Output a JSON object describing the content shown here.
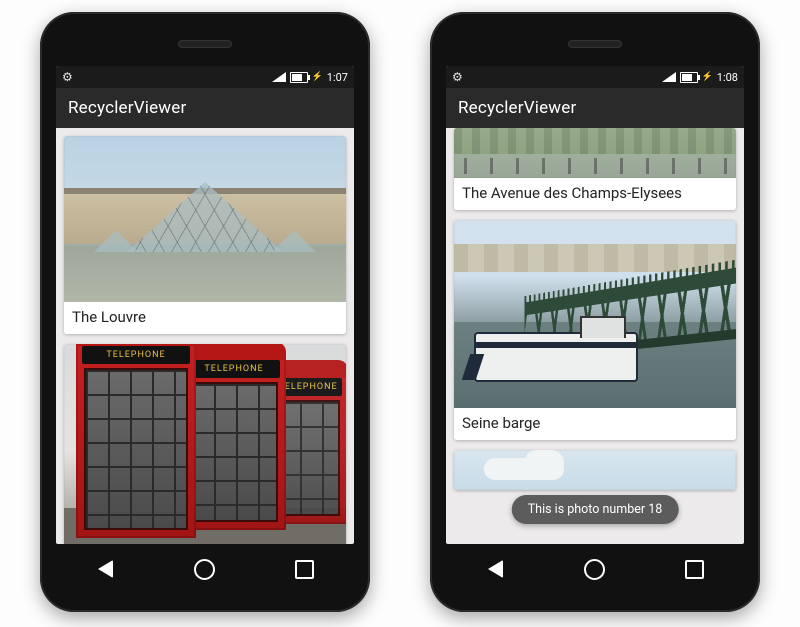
{
  "phones": {
    "left": {
      "status": {
        "time": "1:07",
        "charging_glyph": "⚡"
      },
      "app_title": "RecyclerViewer",
      "cards": [
        {
          "caption": "The Louvre"
        }
      ]
    },
    "right": {
      "status": {
        "time": "1:08",
        "charging_glyph": "⚡"
      },
      "app_title": "RecyclerViewer",
      "cards": [
        {
          "caption": "The Avenue des Champs-Elysees"
        },
        {
          "caption": "Seine barge"
        }
      ],
      "toast": "This is photo number 18"
    }
  },
  "booth_sign": "TELEPHONE"
}
